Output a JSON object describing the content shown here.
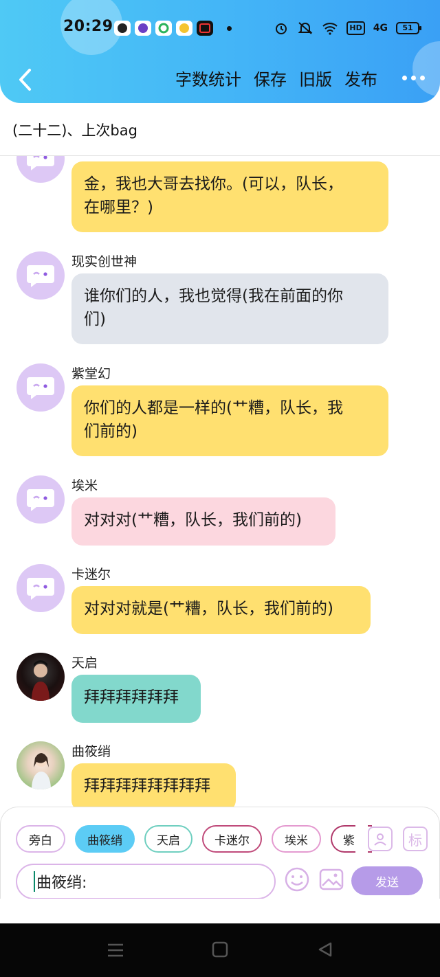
{
  "status_bar": {
    "time": "20:29",
    "network": "4G",
    "hd": "HD",
    "battery": "51"
  },
  "header": {
    "actions": [
      "字数统计",
      "保存",
      "旧版",
      "发布"
    ]
  },
  "chapter": {
    "title": "(二十二)、上次bag"
  },
  "messages": [
    {
      "sender": "",
      "line1": "金，我也大哥去找你。(可以，队长，",
      "line2": "在哪里？)",
      "color": "#ffe070"
    },
    {
      "sender": "现实创世神",
      "line1": "谁你们的人，我也觉得(我在前面的你",
      "line2": "们)",
      "color": "#e1e5ec"
    },
    {
      "sender": "紫堂幻",
      "line1": "你们的人都是一样的(艹糟，队长，我",
      "line2": "们前的)",
      "color": "#ffe070"
    },
    {
      "sender": "埃米",
      "line1": "对对对(艹糟，队长，我们前的)",
      "color": "#fcd7df"
    },
    {
      "sender": "卡迷尔",
      "line1": "对对对就是(艹糟，队长，我们前的)",
      "color": "#ffe070"
    },
    {
      "sender": "天启",
      "line1": "拜拜拜拜拜拜",
      "color": "#82d8cc"
    },
    {
      "sender": "曲筱绡",
      "line1": "拜拜拜拜拜拜拜拜",
      "color": "#ffe070"
    }
  ],
  "composer": {
    "characters": [
      {
        "label": "旁白",
        "border": "#dbb4e8"
      },
      {
        "label": "曲筱绡",
        "border": "#5cccf5"
      },
      {
        "label": "天启",
        "border": "#6fcfc0"
      },
      {
        "label": "卡迷尔",
        "border": "#c04a7a"
      },
      {
        "label": "埃米",
        "border": "#e49ad0"
      },
      {
        "label": "紫",
        "border": "#b0386a"
      }
    ],
    "character_icon": "person-icon",
    "tag_label": "标",
    "input_value": "曲筱绡:",
    "send_label": "发送"
  },
  "colors": {
    "header_start": "#4fc9f5",
    "header_end": "#3aa0f5",
    "bubble_yellow": "#ffe070",
    "send_button": "#b69be8"
  }
}
